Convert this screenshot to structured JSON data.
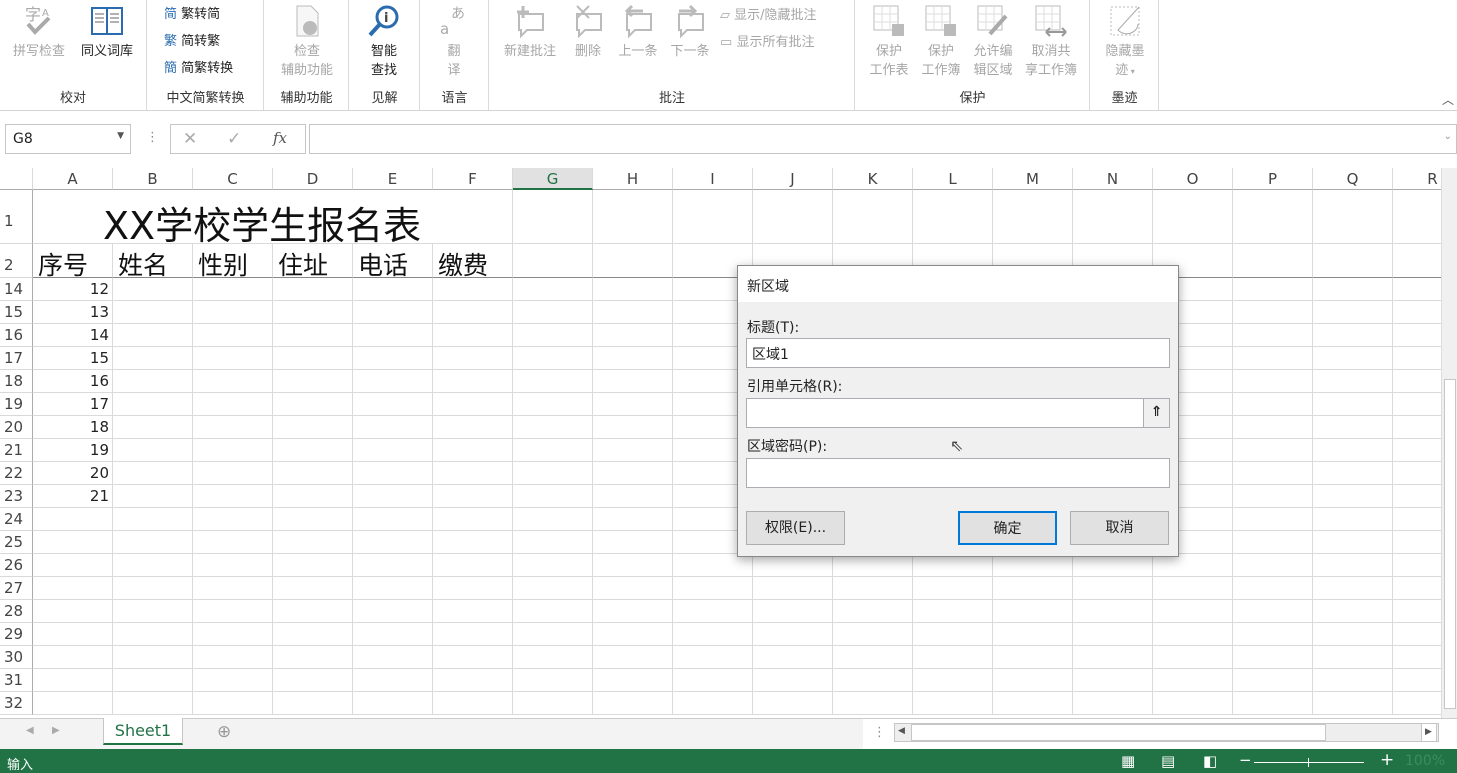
{
  "ribbon": {
    "groups": {
      "proof": "校对",
      "chinese": "中文简繁转换",
      "access": "辅助功能",
      "insights": "见解",
      "language": "语言",
      "comments": "批注",
      "protect": "保护",
      "ink": "墨迹"
    },
    "spell": "拼写检查",
    "thesaurus": "同义词库",
    "to_simplified": "繁转简",
    "to_traditional": "简转繁",
    "convert": "简繁转换",
    "check_access": [
      "检查",
      "辅助功能"
    ],
    "smart_lookup": [
      "智能",
      "查找"
    ],
    "translate": [
      "翻",
      "译"
    ],
    "new_comment": "新建批注",
    "delete": "删除",
    "prev": "上一条",
    "next": "下一条",
    "show_hide": "显示/隐藏批注",
    "show_all": "显示所有批注",
    "protect_sheet": [
      "保护",
      "工作表"
    ],
    "protect_book": [
      "保护",
      "工作簿"
    ],
    "allow_edit": [
      "允许编",
      "辑区域"
    ],
    "unshare": [
      "取消共",
      "享工作簿"
    ],
    "hide_ink": [
      "隐藏墨",
      "迹"
    ]
  },
  "formula_bar": {
    "name_box": "G8",
    "fx": "fx",
    "value": ""
  },
  "sheet": {
    "columns": [
      "A",
      "B",
      "C",
      "D",
      "E",
      "F",
      "G",
      "H",
      "I",
      "J",
      "K",
      "L",
      "M",
      "N",
      "O",
      "P",
      "Q",
      "R"
    ],
    "selected_column": "G",
    "title": "XX学校学生报名表",
    "headers": [
      "序号",
      "姓名",
      "性别",
      "住址",
      "电话",
      "缴费"
    ],
    "rows": [
      {
        "n": "1"
      },
      {
        "n": "2"
      },
      {
        "n": "14",
        "a": "12"
      },
      {
        "n": "15",
        "a": "13"
      },
      {
        "n": "16",
        "a": "14"
      },
      {
        "n": "17",
        "a": "15"
      },
      {
        "n": "18",
        "a": "16"
      },
      {
        "n": "19",
        "a": "17"
      },
      {
        "n": "20",
        "a": "18"
      },
      {
        "n": "21",
        "a": "19"
      },
      {
        "n": "22",
        "a": "20"
      },
      {
        "n": "23",
        "a": "21"
      },
      {
        "n": "24"
      },
      {
        "n": "25"
      },
      {
        "n": "26"
      },
      {
        "n": "27"
      },
      {
        "n": "28"
      },
      {
        "n": "29"
      },
      {
        "n": "30"
      },
      {
        "n": "31"
      },
      {
        "n": "32"
      }
    ]
  },
  "tabs": {
    "sheet1": "Sheet1"
  },
  "status": {
    "mode": "输入",
    "zoom": "100%"
  },
  "dialog": {
    "title": "新区域",
    "title_label": "标题(T):",
    "title_value": "区域1",
    "ref_label": "引用单元格(R):",
    "ref_value": "",
    "pwd_label": "区域密码(P):",
    "pwd_value": "",
    "perm_button": "权限(E)...",
    "ok_button": "确定",
    "cancel_button": "取消"
  }
}
